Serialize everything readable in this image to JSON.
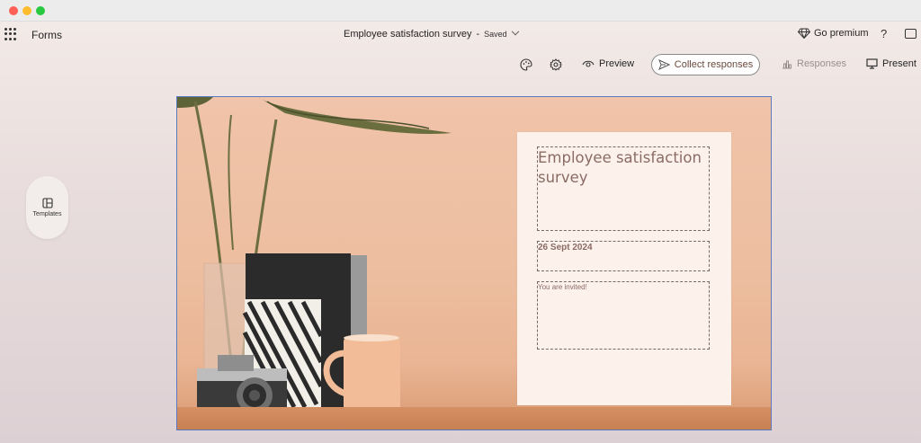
{
  "app": {
    "name": "Forms",
    "doc_title": "Employee satisfaction survey",
    "title_separator": "-",
    "save_status": "Saved",
    "go_premium_label": "Go premium",
    "help_label": "?"
  },
  "toolbar": {
    "preview_label": "Preview",
    "collect_label": "Collect responses",
    "responses_label": "Responses",
    "present_label": "Present"
  },
  "side": {
    "templates_label": "Templates"
  },
  "cover": {
    "title": "Employee satisfaction survey",
    "date": "26 Sept 2024",
    "description": "You are invited!"
  },
  "colors": {
    "accent_text": "#8a6c64",
    "cover_bg": "#f0c4aa",
    "card_bg": "#fdf1ec",
    "selection_border": "#5b7cc0"
  }
}
